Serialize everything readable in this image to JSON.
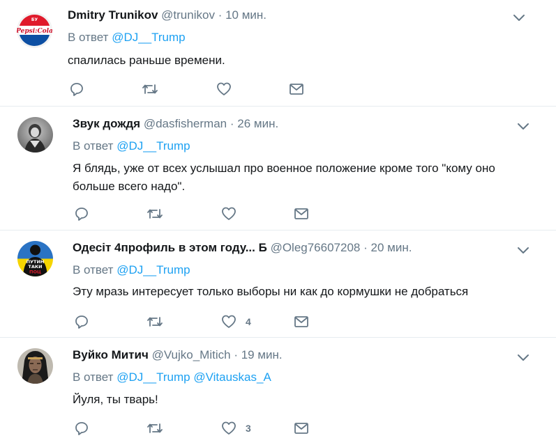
{
  "colors": {
    "link": "#1da1f2",
    "muted": "#657786",
    "text": "#14171a",
    "divider": "#e6ecf0"
  },
  "tweets": [
    {
      "name": "Dmitry Trunikov",
      "handle": "@trunikov",
      "time": "10 мин.",
      "reply_prefix": "В ответ",
      "reply_to": [
        "@DJ__Trump"
      ],
      "text": "спалилась раньше времени.",
      "like_count": "",
      "avatar_icon": "pepsi-cola-bottlecap-avatar",
      "avatar_text": "Pepsi-Cola"
    },
    {
      "name": "Звук дождя",
      "handle": "@dasfisherman",
      "time": "26 мин.",
      "reply_prefix": "В ответ",
      "reply_to": [
        "@DJ__Trump"
      ],
      "text": "Я блядь, уже от всех услышал про военное положение кроме того \"кому оно больше всего надо\".",
      "like_count": "",
      "avatar_icon": "bw-photo-avatar"
    },
    {
      "name": "Одесіт 4профиль в этом году... Б",
      "handle": "@Oleg76607208",
      "time": "20 мин.",
      "reply_prefix": "В ответ",
      "reply_to": [
        "@DJ__Trump"
      ],
      "text": "Эту мразь интересует только выборы ни как до кормушки не добраться",
      "like_count": "4",
      "avatar_icon": "putin-taki-poc-avatar",
      "avatar_text": [
        "ПУТИН",
        "ТАКИ",
        "ПОЦ"
      ]
    },
    {
      "name": "Вуйко Митич",
      "handle": "@Vujko_Mitich",
      "time": "19 мин.",
      "reply_prefix": "В ответ",
      "reply_to": [
        "@DJ__Trump",
        "@Vitauskas_A"
      ],
      "text": "Йуля, ты тварь!",
      "like_count": "3",
      "avatar_icon": "indian-chief-photo-avatar"
    }
  ]
}
